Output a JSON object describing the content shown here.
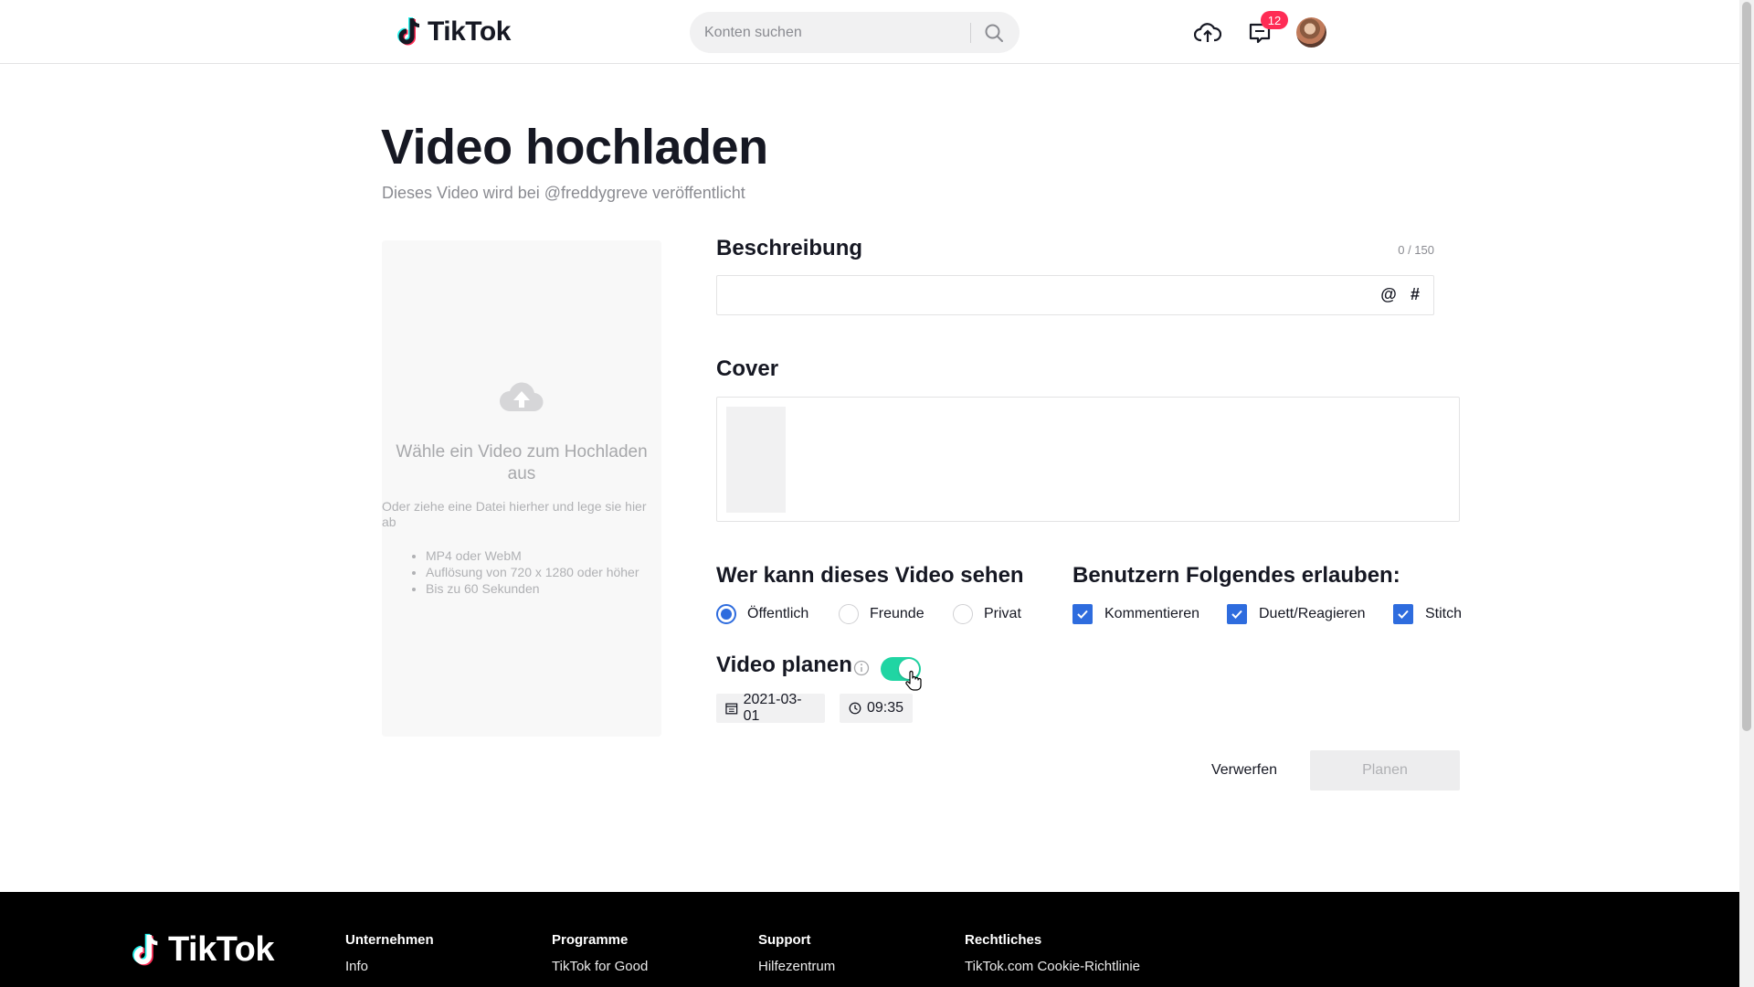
{
  "header": {
    "logo_text": "TikTok",
    "search_placeholder": "Konten suchen",
    "inbox_badge": "12"
  },
  "page": {
    "title": "Video hochladen",
    "subtitle": "Dieses Video wird bei @freddygreve veröffentlicht"
  },
  "upload": {
    "title": "Wähle ein Video zum Hochladen aus",
    "hint": "Oder ziehe eine Datei hierher und lege sie hier ab",
    "requirements": [
      "MP4 oder WebM",
      "Auflösung von 720 x 1280 oder höher",
      "Bis zu 60 Sekunden"
    ]
  },
  "description": {
    "heading": "Beschreibung",
    "counter": "0 / 150",
    "value": "",
    "at_symbol": "@",
    "hash_symbol": "#"
  },
  "cover": {
    "heading": "Cover"
  },
  "visibility": {
    "heading": "Wer kann dieses Video sehen",
    "options": [
      {
        "label": "Öffentlich",
        "checked": true
      },
      {
        "label": "Freunde",
        "checked": false
      },
      {
        "label": "Privat",
        "checked": false
      }
    ]
  },
  "permissions": {
    "heading": "Benutzern Folgendes erlauben:",
    "options": [
      {
        "label": "Kommentieren",
        "checked": true
      },
      {
        "label": "Duett/Reagieren",
        "checked": true
      },
      {
        "label": "Stitch",
        "checked": true
      }
    ]
  },
  "schedule": {
    "heading": "Video planen",
    "enabled": true,
    "date": "2021-03-01",
    "time": "09:35"
  },
  "actions": {
    "discard": "Verwerfen",
    "plan": "Planen"
  },
  "footer": {
    "logo_text": "TikTok",
    "columns": [
      {
        "title": "Unternehmen",
        "links": [
          "Info"
        ]
      },
      {
        "title": "Programme",
        "links": [
          "TikTok for Good"
        ]
      },
      {
        "title": "Support",
        "links": [
          "Hilfezentrum"
        ]
      },
      {
        "title": "Rechtliches",
        "links": [
          "TikTok.com Cookie-Richtlinie"
        ]
      }
    ]
  },
  "colors": {
    "accent": "#fe2c55",
    "checkbox_blue": "#2e6cde",
    "toggle_on": "#20d5a3"
  }
}
